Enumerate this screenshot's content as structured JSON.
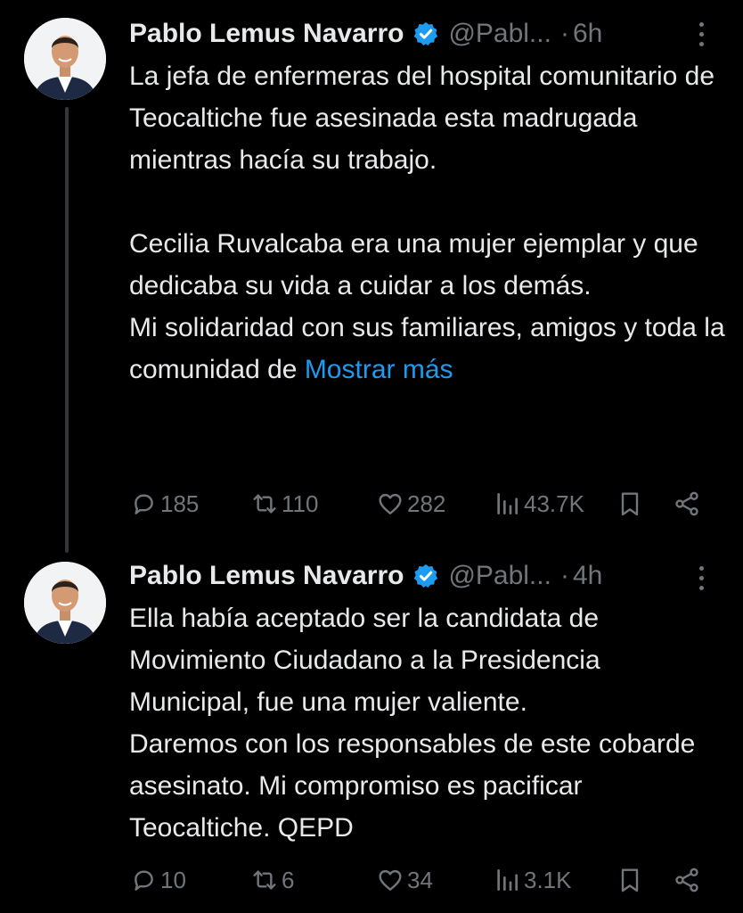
{
  "tweets": [
    {
      "author": "Pablo Lemus Navarro",
      "handle": "@Pabl...",
      "dot": "·",
      "time": "6h",
      "paragraphs": [
        "La jefa de enfermeras del hospital comunitario de Teocaltiche fue asesinada esta madrugada mientras hacía su trabajo.",
        "Cecilia Ruvalcaba era una mujer ejemplar y que dedicaba su vida a cuidar a los demás.",
        "Mi solidaridad con sus familiares, amigos y toda la comunidad de"
      ],
      "show_more": "Mostrar más",
      "replies": "185",
      "reposts": "110",
      "likes": "282",
      "views": "43.7K"
    },
    {
      "author": "Pablo Lemus Navarro",
      "handle": "@Pabl...",
      "dot": "·",
      "time": "4h",
      "paragraphs": [
        "Ella había aceptado ser la candidata de Movimiento Ciudadano a la Presidencia Municipal, fue una mujer valiente.",
        "Daremos con los responsables de este cobarde asesinato. Mi compromiso es pacificar Teocaltiche. QEPD"
      ],
      "replies": "10",
      "reposts": "6",
      "likes": "34",
      "views": "3.1K"
    }
  ],
  "icons": {
    "verified": "verified-badge-icon",
    "more": "more-options-icon",
    "reply": "reply-icon",
    "repost": "repost-icon",
    "like": "like-icon",
    "views": "views-icon",
    "bookmark": "bookmark-icon",
    "share": "share-icon"
  },
  "colors": {
    "background": "#000000",
    "text": "#e7e9ea",
    "secondary": "#71767b",
    "link": "#1d9bf0",
    "verified": "#1d9bf0"
  }
}
